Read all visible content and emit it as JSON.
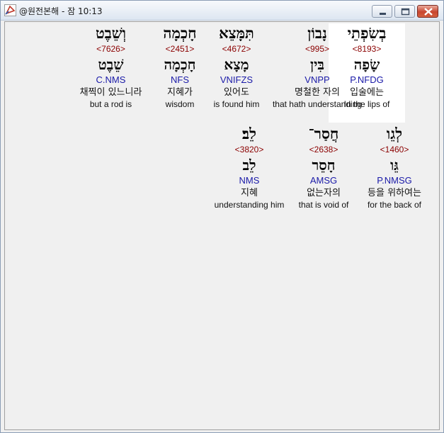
{
  "window": {
    "title": "@원전본해 - 잠 10:13"
  },
  "rows": [
    {
      "words": [
        {
          "hebrew": "בְשִׂפְתֵי",
          "strong": "<8193>",
          "root": "שָׂפָה",
          "morph": "P.NFDG",
          "korean": "입술에는",
          "english": "In the lips of",
          "highlight": true
        },
        {
          "hebrew": "נָבוֹן",
          "strong": "<995>",
          "root": "בִּין",
          "morph": "VNPP",
          "korean": "명철한 자의",
          "english": "that hath understanding",
          "highlight": false
        },
        {
          "hebrew": "תִּמָּצֵא",
          "strong": "<4672>",
          "root": "מָצָא",
          "morph": "VNIFZS",
          "korean": "있어도",
          "english": "is found him",
          "highlight": false
        },
        {
          "hebrew": "חָכְמָה",
          "strong": "<2451>",
          "root": "חָכְמָה",
          "morph": "NFS",
          "korean": "지혜가",
          "english": "wisdom",
          "highlight": false
        },
        {
          "hebrew": "וְשֵׁבֶט",
          "strong": "<7626>",
          "root": "שֵׁבֶט",
          "morph": "C.NMS",
          "korean": "채찍이 있느니라",
          "english": "but a rod is",
          "highlight": false
        }
      ]
    },
    {
      "words": [
        {
          "hebrew": "לְגֵו",
          "strong": "<1460>",
          "root": "גֵּו",
          "morph": "P.NMSG",
          "korean": "등을 위하여는",
          "english": "for the back of",
          "highlight": false
        },
        {
          "hebrew": "חֲסַר־",
          "strong": "<2638>",
          "root": "חָסֵר",
          "morph": "AMSG",
          "korean": "없는자의",
          "english": "that is void of",
          "highlight": false
        },
        {
          "hebrew": "לֵב׃",
          "strong": "<3820>",
          "root": "לֵב",
          "morph": "NMS",
          "korean": "지혜",
          "english": "understanding him",
          "highlight": false
        }
      ]
    }
  ]
}
